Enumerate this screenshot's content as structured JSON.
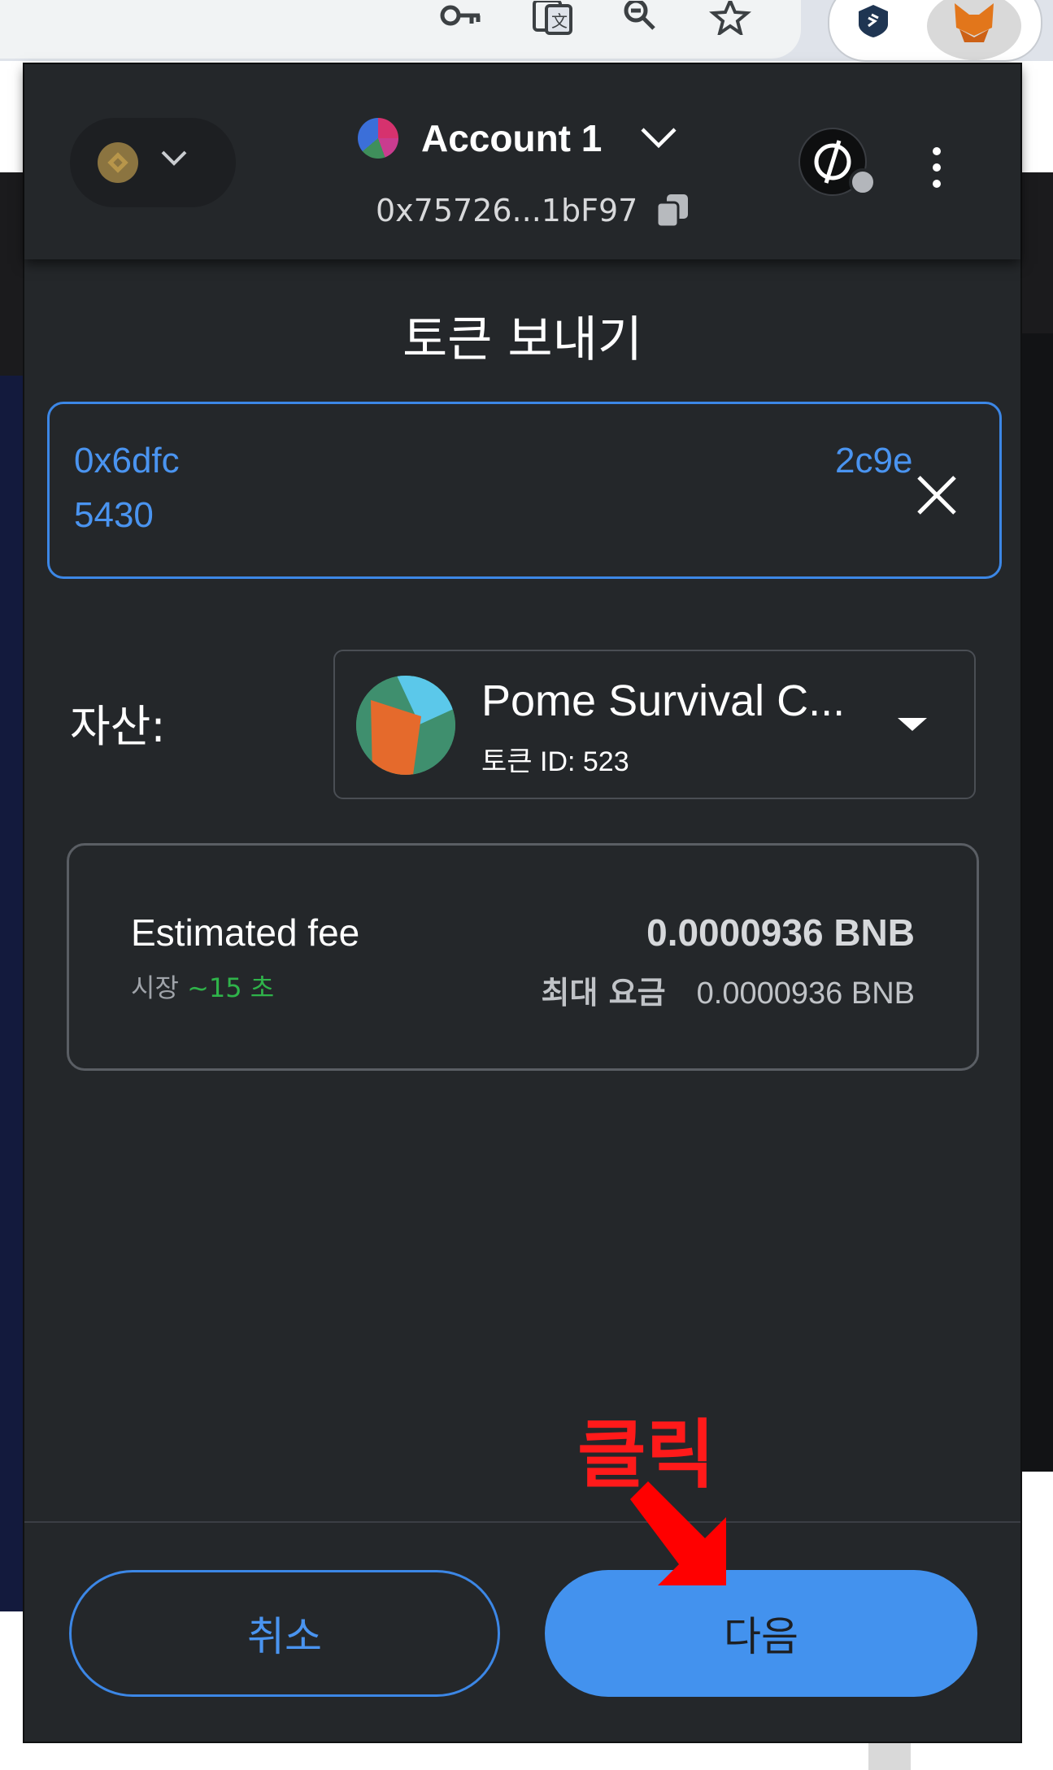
{
  "browser": {
    "toolbar_icons": [
      "key-icon",
      "translate-icon",
      "zoom-icon",
      "bookmark-star-icon"
    ],
    "extension_icons": [
      "extension-shield-icon",
      "metamask-fox-icon"
    ]
  },
  "header": {
    "network_icon": "bnb-chain-icon",
    "account_name": "Account 1",
    "account_address": "0x75726...1bF97",
    "copy_icon": "copy-icon",
    "connected_site_icon": "connected-site-icon"
  },
  "send": {
    "title": "토큰 보내기",
    "recipient_line1_start": "0x6dfc",
    "recipient_line1_end": "2c9e",
    "recipient_line2": "5430",
    "asset_label": "자산:",
    "asset_name": "Pome Survival C...",
    "asset_token_id": "토큰 ID: 523"
  },
  "fee": {
    "label": "Estimated fee",
    "speed": "시장",
    "time": "~15 초",
    "value": "0.0000936 BNB",
    "max_label": "최대 요금",
    "max_value": "0.0000936 BNB"
  },
  "footer": {
    "cancel_label": "취소",
    "next_label": "다음"
  },
  "annotation": {
    "text": "클릭",
    "color": "#ff1a1a"
  },
  "colors": {
    "accent": "#4392ee",
    "background": "#24272a",
    "success": "#2fb34a"
  }
}
